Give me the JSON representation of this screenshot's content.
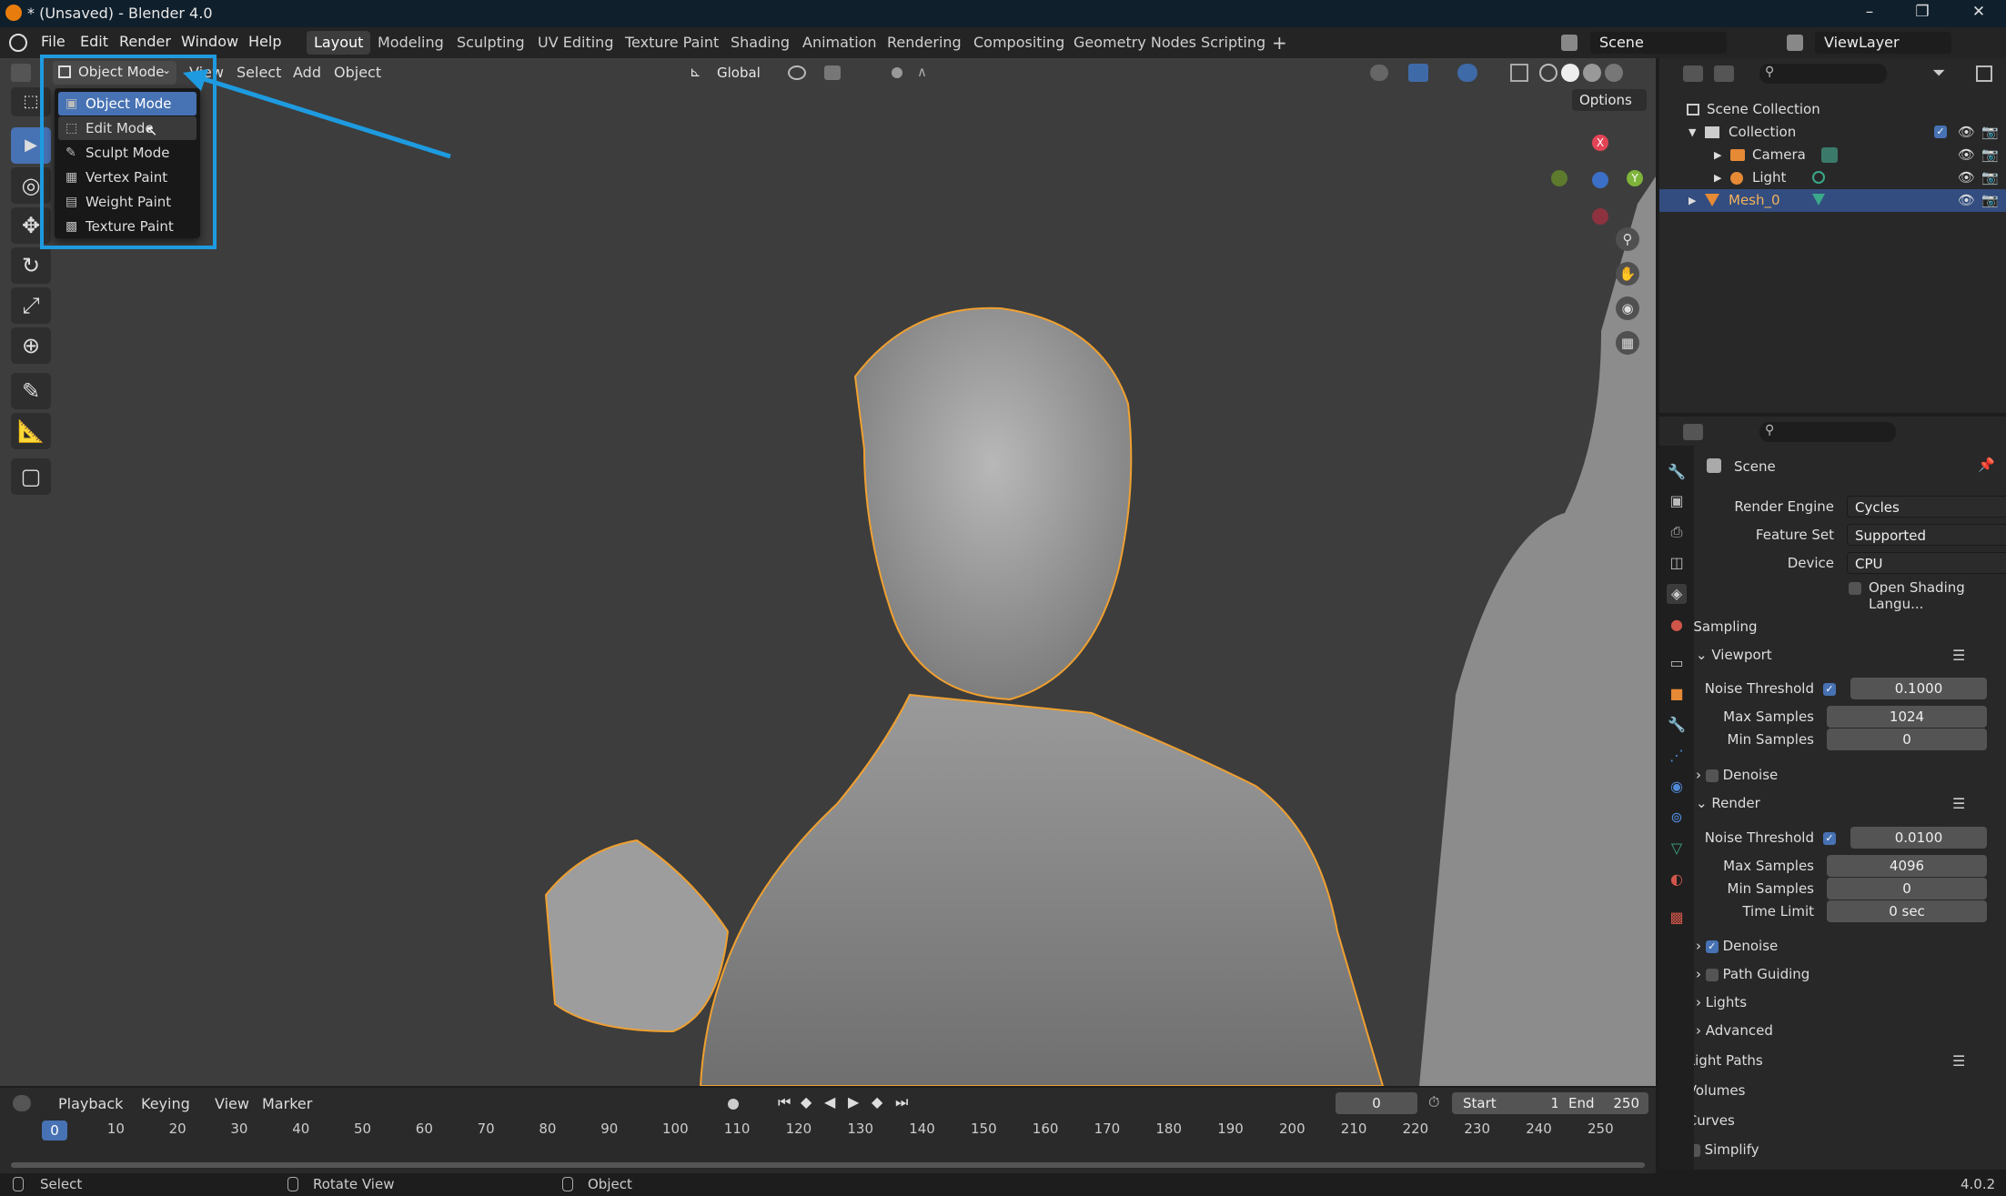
{
  "window": {
    "title": "* (Unsaved) - Blender 4.0"
  },
  "menus": [
    "File",
    "Edit",
    "Render",
    "Window",
    "Help"
  ],
  "workspaces": [
    "Layout",
    "Modeling",
    "Sculpting",
    "UV Editing",
    "Texture Paint",
    "Shading",
    "Animation",
    "Rendering",
    "Compositing",
    "Geometry Nodes",
    "Scripting"
  ],
  "active_workspace": "Layout",
  "scene_field": "Scene",
  "viewlayer_field": "ViewLayer",
  "viewport": {
    "mode_label": "Object Mode",
    "header_menus": [
      "View",
      "Select",
      "Add",
      "Object"
    ],
    "orientation": "Global",
    "options_label": "Options",
    "gizmo": {
      "x": "X",
      "y": "Y"
    }
  },
  "mode_dropdown": [
    {
      "label": "Object Mode",
      "icon": "object-mode-icon"
    },
    {
      "label": "Edit Mode",
      "icon": "edit-mode-icon"
    },
    {
      "label": "Sculpt Mode",
      "icon": "sculpt-mode-icon"
    },
    {
      "label": "Vertex Paint",
      "icon": "vertex-paint-icon"
    },
    {
      "label": "Weight Paint",
      "icon": "weight-paint-icon"
    },
    {
      "label": "Texture Paint",
      "icon": "texture-paint-icon"
    }
  ],
  "outliner": {
    "root": "Scene Collection",
    "collection": "Collection",
    "items": [
      "Camera",
      "Light",
      "Mesh_0"
    ]
  },
  "properties": {
    "header": "Scene",
    "render_engine_label": "Render Engine",
    "render_engine": "Cycles",
    "feature_set_label": "Feature Set",
    "feature_set": "Supported",
    "device_label": "Device",
    "device": "CPU",
    "osl_label": "Open Shading Langu...",
    "sampling": "Sampling",
    "viewport_sub": "Viewport",
    "render_sub": "Render",
    "noise_threshold_label": "Noise Threshold",
    "max_samples_label": "Max Samples",
    "min_samples_label": "Min Samples",
    "time_limit_label": "Time Limit",
    "viewport_noise": "0.1000",
    "viewport_max": "1024",
    "viewport_min": "0",
    "denoise": "Denoise",
    "render_noise": "0.0100",
    "render_max": "4096",
    "render_min": "0",
    "time_limit": "0 sec",
    "path_guiding": "Path Guiding",
    "lights": "Lights",
    "advanced": "Advanced",
    "light_paths": "Light Paths",
    "volumes": "Volumes",
    "curves": "Curves",
    "simplify": "Simplify"
  },
  "timeline": {
    "menus": [
      "Playback",
      "Keying",
      "View",
      "Marker"
    ],
    "current_frame": "0",
    "start_label": "Start",
    "start": "1",
    "end_label": "End",
    "end": "250",
    "ticks": [
      "0",
      "10",
      "20",
      "30",
      "40",
      "50",
      "60",
      "70",
      "80",
      "90",
      "100",
      "110",
      "120",
      "130",
      "140",
      "150",
      "160",
      "170",
      "180",
      "190",
      "200",
      "210",
      "220",
      "230",
      "240",
      "250"
    ]
  },
  "status": {
    "select": "Select",
    "rotate": "Rotate View",
    "object": "Object",
    "version": "4.0.2"
  },
  "colors": {
    "accent": "#4772b3",
    "highlight": "#1e9be0",
    "selection_outline": "#f0a030"
  }
}
